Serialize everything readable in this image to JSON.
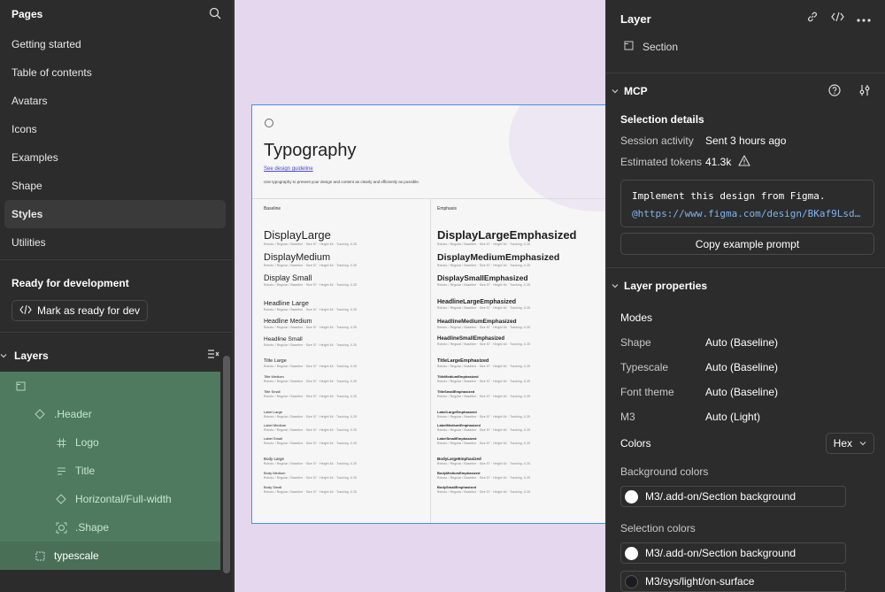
{
  "left": {
    "pages_title": "Pages",
    "pages": [
      "Getting started",
      "Table of contents",
      "Avatars",
      "Icons",
      "Examples",
      "Shape",
      "Styles",
      "Utilities"
    ],
    "active_page": "Styles",
    "ready_title": "Ready for development",
    "mark_button": "Mark as ready for dev",
    "layers_title": "Layers",
    "layers": [
      {
        "label": "",
        "icon": "section-icon"
      },
      {
        "label": ".Header",
        "icon": "component-instance-icon"
      },
      {
        "label": "Logo",
        "icon": "frame-icon"
      },
      {
        "label": "Title",
        "icon": "text-icon"
      },
      {
        "label": "Horizontal/Full-width",
        "icon": "component-instance-icon"
      },
      {
        "label": ".Shape",
        "icon": "component-icon"
      },
      {
        "label": "typescale",
        "icon": "section-icon"
      }
    ]
  },
  "canvas": {
    "title": "Typography",
    "link": "See design guideline",
    "description": "Use typography to present your design and content as clearly and efficiently as possible.",
    "col_baseline": "Baseline",
    "col_emphasis": "Emphasis",
    "baseline": [
      "DisplayLarge",
      "DisplayMedium",
      "Display Small",
      "Headline Large",
      "Headline Medium",
      "Headline Small",
      "Title Large",
      "Title Medium",
      "Title Small",
      "Label Large",
      "Label Medium",
      "Label Small",
      "Body Large",
      "Body Medium",
      "Body Small"
    ],
    "emphasis": [
      "DisplayLargeEmphasized",
      "DisplayMediumEmphasized",
      "DisplaySmallEmphasized",
      "HeadlineLargeEmphasized",
      "HeadlineMediumEmphasized",
      "HeadlineSmallEmphasized",
      "TitleLargeEmphasized",
      "TitleMediumEmphasized",
      "TitleSmallEmphasized",
      "LabelLargeEmphasized",
      "LabelMediumEmphasized",
      "LabelSmallEmphasized",
      "BodyLargeEmphasized",
      "BodyMediumEmphasized",
      "BodySmallEmphasized"
    ],
    "sub": "Roboto / Regular / Baseline · Size 57 · Height 64 · Tracking -0.25"
  },
  "right": {
    "title": "Layer",
    "layer_type": "Section",
    "mcp": {
      "title": "MCP",
      "selection_details": "Selection details",
      "session_label": "Session activity",
      "session_value": "Sent 3 hours ago",
      "tokens_label": "Estimated tokens",
      "tokens_value": "41.3k",
      "code_line1": "Implement this design from Figma.",
      "code_line2": "@https://www.figma.com/design/BKaf9Lsd…",
      "copy_button": "Copy example prompt"
    },
    "props": {
      "title": "Layer properties",
      "modes_label": "Modes",
      "rows": [
        {
          "k": "Shape",
          "v": "Auto (Baseline)"
        },
        {
          "k": "Typescale",
          "v": "Auto (Baseline)"
        },
        {
          "k": "Font theme",
          "v": "Auto (Baseline)"
        },
        {
          "k": "M3",
          "v": "Auto (Light)"
        }
      ],
      "colors_label": "Colors",
      "hex": "Hex",
      "bg_label": "Background colors",
      "bg_color": "M3/.add-on/Section background",
      "sel_label": "Selection colors",
      "sel_colors": [
        "M3/.add-on/Section background",
        "M3/sys/light/on-surface"
      ]
    }
  }
}
